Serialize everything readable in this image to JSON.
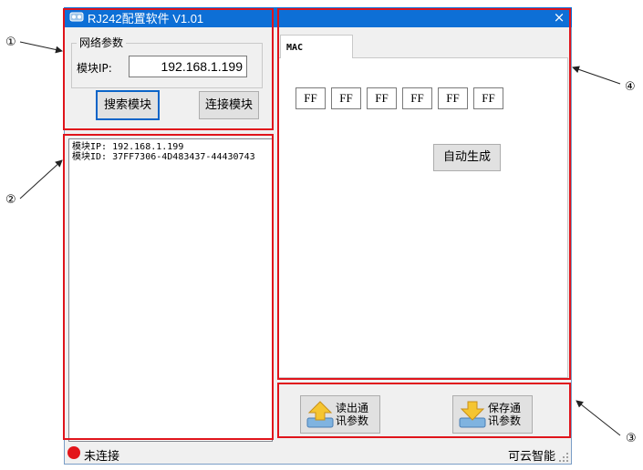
{
  "window": {
    "title": "RJ242配置软件 V1.01",
    "close_glyph": "×"
  },
  "network": {
    "legend": "网络参数",
    "ip_label": "模块IP:",
    "ip_value": "192.168.1.199",
    "search_button": "搜索模块",
    "connect_button": "连接模块"
  },
  "log": {
    "lines": [
      "模块IP: 192.168.1.199",
      "模块ID: 37FF7306-4D483437-44430743"
    ]
  },
  "tabs": [
    {
      "label": "MAC",
      "active": true
    }
  ],
  "mac": {
    "octets": [
      "FF",
      "FF",
      "FF",
      "FF",
      "FF",
      "FF"
    ],
    "auto_button": "自动生成"
  },
  "params": {
    "read_button": [
      "读出通",
      "讯参数"
    ],
    "save_button": [
      "保存通",
      "讯参数"
    ]
  },
  "status": {
    "state": "未连接",
    "state_color": "#e3151a",
    "vendor": "可云智能"
  },
  "callouts": [
    "①",
    "②",
    "③",
    "④"
  ],
  "colors": {
    "titlebar": "#0d6fd6",
    "highlight": "#e0141b"
  }
}
